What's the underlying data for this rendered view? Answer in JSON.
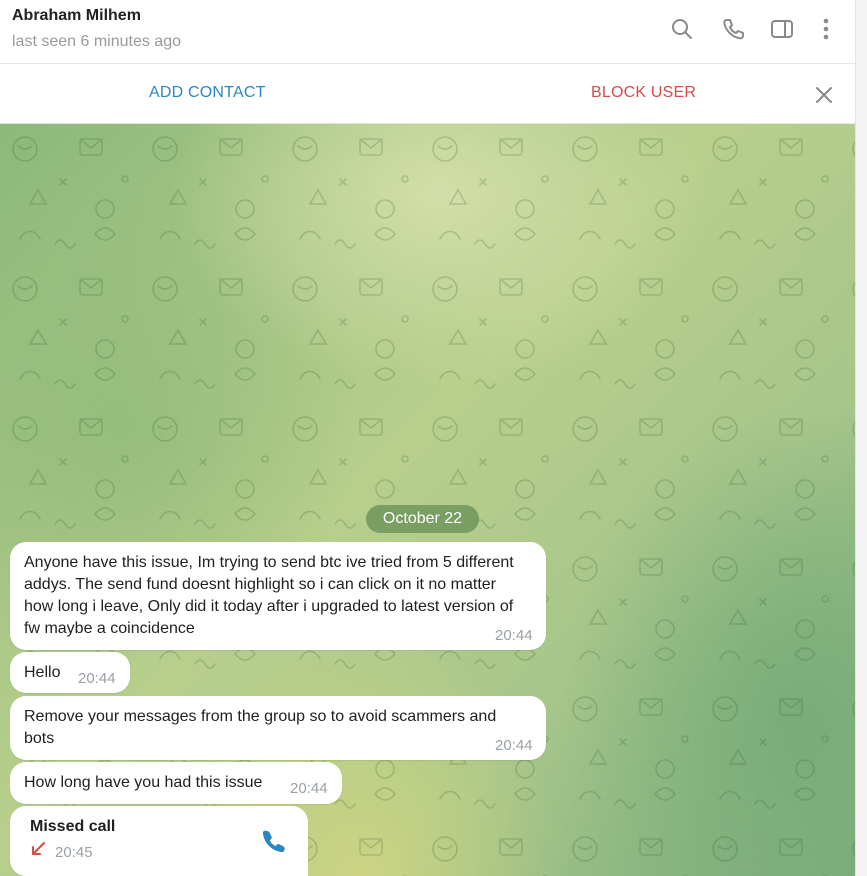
{
  "header": {
    "name": "Abraham Milhem",
    "status": "last seen 6 minutes ago",
    "icons": [
      "search-icon",
      "phone-icon",
      "sidebar-toggle-icon",
      "more-vertical-icon"
    ]
  },
  "action_bar": {
    "add_contact": "ADD CONTACT",
    "block_user": "BLOCK USER",
    "close_icon": "close-icon"
  },
  "chat": {
    "date_separator": "October 22",
    "messages": [
      {
        "text": "Anyone have this issue, Im trying to send btc ive tried from 5 different addys. The send fund doesnt highlight so i can click on it no matter how long i leave, Only did it today after i upgraded to latest version of fw maybe a coincidence",
        "time": "20:44"
      },
      {
        "text": "Hello",
        "time": "20:44"
      },
      {
        "text": "Remove your messages from the group so to avoid scammers and bots",
        "time": "20:44"
      },
      {
        "text": "How long have you had this issue",
        "time": "20:44"
      }
    ],
    "missed_call": {
      "title": "Missed call",
      "time": "20:45",
      "icon": "phone-icon"
    }
  },
  "colors": {
    "accent": "#2b87c3",
    "danger": "#d84a45",
    "bubble": "#ffffff",
    "date_pill": "#6e965a"
  }
}
